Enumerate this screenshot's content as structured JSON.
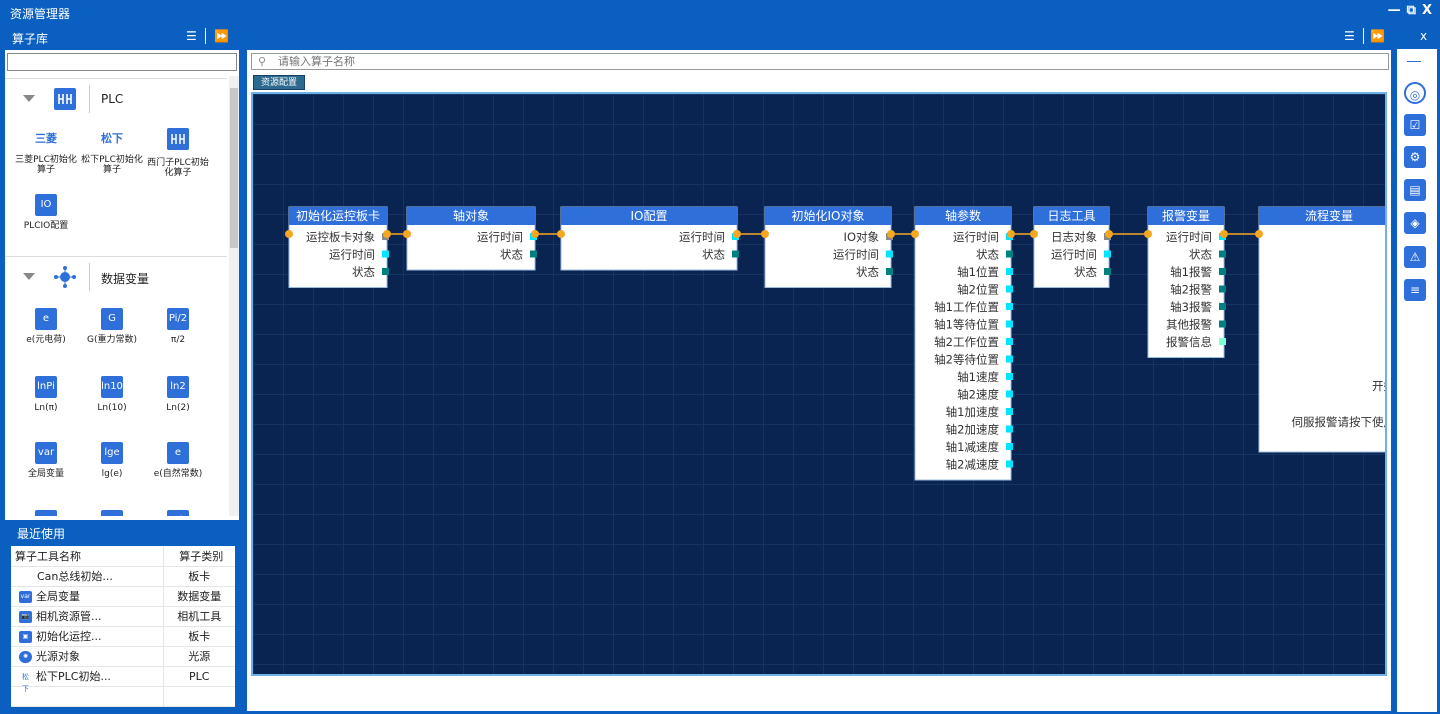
{
  "window": {
    "title": "资源管理器",
    "controls": [
      "—",
      "⧉",
      "X"
    ]
  },
  "left_section": {
    "title": "算子库"
  },
  "right_section": {
    "close": "x"
  },
  "library": {
    "search_value": "",
    "groups": [
      {
        "name": "PLC",
        "tools": [
          {
            "icon": "三菱",
            "label": "三菱PLC初始化算子"
          },
          {
            "icon": "松下",
            "label": "松下PLC初始化算子"
          },
          {
            "icon": "siemens-plc-icon",
            "label": "西门子PLC初始化算子"
          },
          {
            "icon": "IO",
            "label": "PLCIO配置"
          }
        ]
      },
      {
        "name": "数据变量",
        "tools": [
          {
            "icon": "e",
            "label": "e(元电荷)"
          },
          {
            "icon": "G",
            "label": "G(重力常数)"
          },
          {
            "icon": "Pi/2",
            "label": "π/2"
          },
          {
            "icon": "lnPi",
            "label": "Ln(π)"
          },
          {
            "icon": "ln10",
            "label": "Ln(10)"
          },
          {
            "icon": "ln2",
            "label": "Ln(2)"
          },
          {
            "icon": "var",
            "label": "全局变量"
          },
          {
            "icon": "lge",
            "label": "lg(e)"
          },
          {
            "icon": "e",
            "label": "e(自然常数)"
          },
          {
            "icon": "1/e",
            "label": ""
          },
          {
            "icon": "1/π",
            "label": ""
          },
          {
            "icon": "Pi",
            "label": ""
          }
        ]
      }
    ]
  },
  "recent": {
    "title": "最近使用",
    "headers": [
      "算子工具名称",
      "算子类别"
    ],
    "rows": [
      {
        "icon": "",
        "name": "Can总线初始...",
        "category": "板卡"
      },
      {
        "icon": "var",
        "name": "全局变量",
        "category": "数据变量"
      },
      {
        "icon": "cam",
        "name": "相机资源管...",
        "category": "相机工具"
      },
      {
        "icon": "io",
        "name": "初始化运控...",
        "category": "板卡"
      },
      {
        "icon": "light",
        "name": "光源对象",
        "category": "光源"
      },
      {
        "icon": "松下",
        "name": "松下PLC初始...",
        "category": "PLC"
      }
    ]
  },
  "editor": {
    "search_placeholder": "请输入算子名称",
    "tab": "资源配置",
    "nodes": [
      {
        "title": "初始化运控板卡",
        "ports": [
          {
            "label": "运控板卡对象",
            "color": "#888888"
          },
          {
            "label": "运行时间",
            "color": "#00e5ff"
          },
          {
            "label": "状态",
            "color": "#008080"
          }
        ]
      },
      {
        "title": "轴对象",
        "ports": [
          {
            "label": "运行时间",
            "color": "#00e5ff"
          },
          {
            "label": "状态",
            "color": "#008080"
          }
        ]
      },
      {
        "title": "IO配置",
        "ports": [
          {
            "label": "运行时间",
            "color": "#00e5ff"
          },
          {
            "label": "状态",
            "color": "#008080"
          }
        ]
      },
      {
        "title": "初始化IO对象",
        "ports": [
          {
            "label": "IO对象",
            "color": "#888888"
          },
          {
            "label": "运行时间",
            "color": "#00e5ff"
          },
          {
            "label": "状态",
            "color": "#008080"
          }
        ]
      },
      {
        "title": "轴参数",
        "ports": [
          {
            "label": "运行时间",
            "color": "#00e5ff"
          },
          {
            "label": "状态",
            "color": "#008080"
          },
          {
            "label": "轴1位置",
            "color": "#00e5ff"
          },
          {
            "label": "轴2位置",
            "color": "#00e5ff"
          },
          {
            "label": "轴1工作位置",
            "color": "#00e5ff"
          },
          {
            "label": "轴1等待位置",
            "color": "#00e5ff"
          },
          {
            "label": "轴2工作位置",
            "color": "#00e5ff"
          },
          {
            "label": "轴2等待位置",
            "color": "#00e5ff"
          },
          {
            "label": "轴1速度",
            "color": "#00e5ff"
          },
          {
            "label": "轴2速度",
            "color": "#00e5ff"
          },
          {
            "label": "轴1加速度",
            "color": "#00e5ff"
          },
          {
            "label": "轴2加速度",
            "color": "#00e5ff"
          },
          {
            "label": "轴1减速度",
            "color": "#00e5ff"
          },
          {
            "label": "轴2减速度",
            "color": "#00e5ff"
          }
        ]
      },
      {
        "title": "日志工具",
        "ports": [
          {
            "label": "日志对象",
            "color": "#888888"
          },
          {
            "label": "运行时间",
            "color": "#00e5ff"
          },
          {
            "label": "状态",
            "color": "#008080"
          }
        ]
      },
      {
        "title": "报警变量",
        "ports": [
          {
            "label": "运行时间",
            "color": "#00e5ff"
          },
          {
            "label": "状态",
            "color": "#008080"
          },
          {
            "label": "轴1报警",
            "color": "#008080"
          },
          {
            "label": "轴2报警",
            "color": "#008080"
          },
          {
            "label": "轴3报警",
            "color": "#008080"
          },
          {
            "label": "其他报警",
            "color": "#008080"
          },
          {
            "label": "报警信息",
            "color": "#7fffd4"
          }
        ]
      },
      {
        "title": "流程变量",
        "ports": [],
        "texts": [
          "开始",
          "伺服报警请按下使用"
        ]
      }
    ]
  }
}
